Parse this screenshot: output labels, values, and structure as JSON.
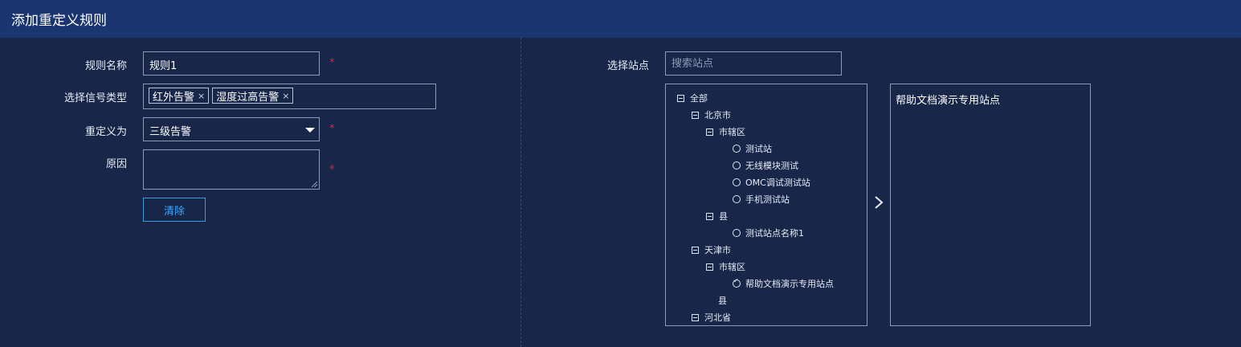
{
  "header": {
    "title": "添加重定义规则"
  },
  "form": {
    "rule_name": {
      "label": "规则名称",
      "value": "规则1",
      "required_mark": "*"
    },
    "signal_type": {
      "label": "选择信号类型",
      "tags": [
        "红外告警",
        "湿度过高告警"
      ],
      "remove_glyph": "×"
    },
    "redefine_as": {
      "label": "重定义为",
      "value": "三级告警",
      "required_mark": "*"
    },
    "reason": {
      "label": "原因",
      "value": "",
      "required_mark": "*"
    },
    "clear_button": "清除"
  },
  "station": {
    "label": "选择站点",
    "search_placeholder": "搜索站点",
    "tree": {
      "all": "全部",
      "beijing": "北京市",
      "beijing_district": "市辖区",
      "beijing_stations": [
        "测试站",
        "无线模块测试",
        "OMC调试测试站",
        "手机测试站"
      ],
      "beijing_county": "县",
      "beijing_county_station": "测试站点名称1",
      "tianjin": "天津市",
      "tianjin_district": "市辖区",
      "tianjin_station": "帮助文档演示专用站点",
      "tianjin_county": "县",
      "hebei": "河北省"
    },
    "selected": [
      "帮助文档演示专用站点"
    ]
  },
  "colors": {
    "header_bg": "#1b3570",
    "page_bg": "#172649",
    "required": "#e0243a",
    "button_border": "#3a9be0"
  }
}
